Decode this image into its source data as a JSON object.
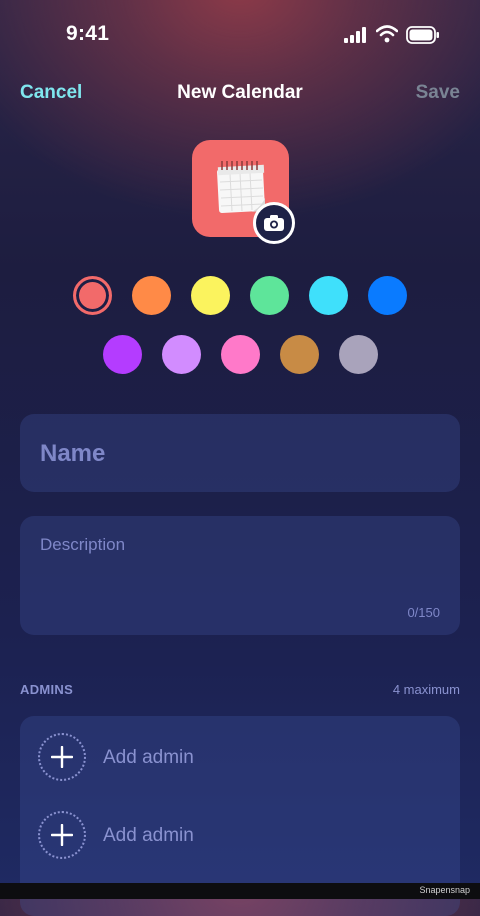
{
  "status": {
    "time": "9:41"
  },
  "nav": {
    "cancel": "Cancel",
    "title": "New Calendar",
    "save": "Save"
  },
  "calendar_icon": {
    "color": "#f26a6a",
    "icon": "calendar-icon",
    "edit_icon": "camera-icon"
  },
  "colors": {
    "selected": "#f26a6a",
    "row1": [
      "#f26a6a",
      "#ff8a47",
      "#fbf35e",
      "#5ee59a",
      "#3fe0fb",
      "#0a7bff"
    ],
    "row2": [
      "#b43cff",
      "#d28cff",
      "#ff79c9",
      "#c88b45",
      "#a9a3bb"
    ]
  },
  "form": {
    "name_placeholder": "Name",
    "description_placeholder": "Description",
    "description_counter": "0/150"
  },
  "admins": {
    "header": "ADMINS",
    "limit": "4 maximum",
    "items": [
      {
        "label": "Add admin"
      },
      {
        "label": "Add admin"
      }
    ]
  },
  "footer": {
    "watermark": "Snapensnap"
  }
}
